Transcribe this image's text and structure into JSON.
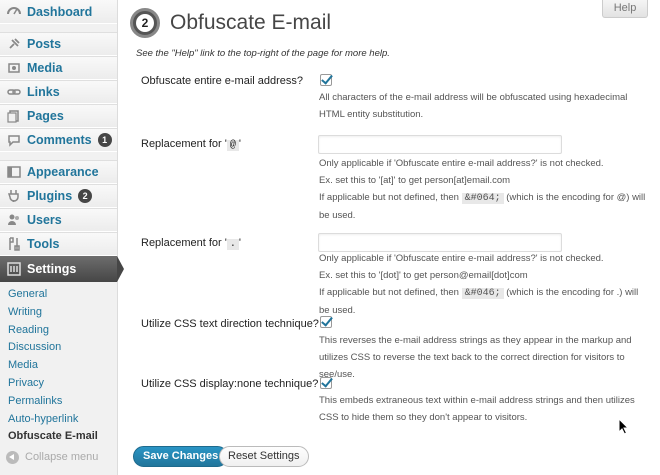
{
  "sidebar": {
    "items": [
      {
        "label": "Dashboard",
        "icon": "dashboard-icon"
      },
      {
        "label": "Posts",
        "icon": "pin-icon"
      },
      {
        "label": "Media",
        "icon": "media-icon"
      },
      {
        "label": "Links",
        "icon": "link-icon"
      },
      {
        "label": "Pages",
        "icon": "pages-icon"
      },
      {
        "label": "Comments",
        "icon": "comment-icon",
        "badge": "1"
      },
      {
        "label": "Appearance",
        "icon": "appearance-icon"
      },
      {
        "label": "Plugins",
        "icon": "plug-icon",
        "badge": "2"
      },
      {
        "label": "Users",
        "icon": "users-icon"
      },
      {
        "label": "Tools",
        "icon": "tools-icon"
      },
      {
        "label": "Settings",
        "icon": "settings-icon"
      }
    ],
    "submenu": [
      "General",
      "Writing",
      "Reading",
      "Discussion",
      "Media",
      "Privacy",
      "Permalinks",
      "Auto-hyperlink",
      "Obfuscate E-mail"
    ],
    "collapse_label": "Collapse menu"
  },
  "help_label": "Help",
  "page": {
    "title": "Obfuscate E-mail",
    "icon_number": "2",
    "intro": "See the \"Help\" link to the top-right of the page for more help."
  },
  "settings": {
    "entire": {
      "label": "Obfuscate entire e-mail address?",
      "desc": "All characters of the e-mail address will be obfuscated using hexadecimal HTML entity substitution."
    },
    "at": {
      "label_prefix": "Replacement for '",
      "label_code": "@",
      "label_suffix": "'",
      "desc1": "Only applicable if 'Obfuscate entire e-mail address?' is not checked.",
      "desc2": "Ex. set this to '[at]' to get person[at]email.com",
      "desc3a": "If applicable but not defined, then",
      "desc3code": "&#064;",
      "desc3b": "(which is the encoding for @) will be used.",
      "value": ""
    },
    "dot": {
      "label_prefix": "Replacement for '",
      "label_code": ".",
      "label_suffix": "'",
      "desc1": "Only applicable if 'Obfuscate entire e-mail address?' is not checked.",
      "desc2": "Ex. set this to '[dot]' to get person@email[dot]com",
      "desc3a": "If applicable but not defined, then",
      "desc3code": "&#046;",
      "desc3b": "(which is the encoding for .) will be used.",
      "value": ""
    },
    "css_direction": {
      "label": "Utilize CSS text direction technique?",
      "desc": "This reverses the e-mail address strings as they appear in the markup and utilizes CSS to reverse the text back to the correct direction for visitors to see/use."
    },
    "css_display": {
      "label": "Utilize CSS display:none technique?",
      "desc": "This embeds extraneous text within e-mail address strings and then utilizes CSS to hide them so they don't appear to visitors."
    }
  },
  "buttons": {
    "save": "Save Changes",
    "reset": "Reset Settings"
  },
  "colors": {
    "accent": "#21759b",
    "current_menu": "#464646"
  }
}
